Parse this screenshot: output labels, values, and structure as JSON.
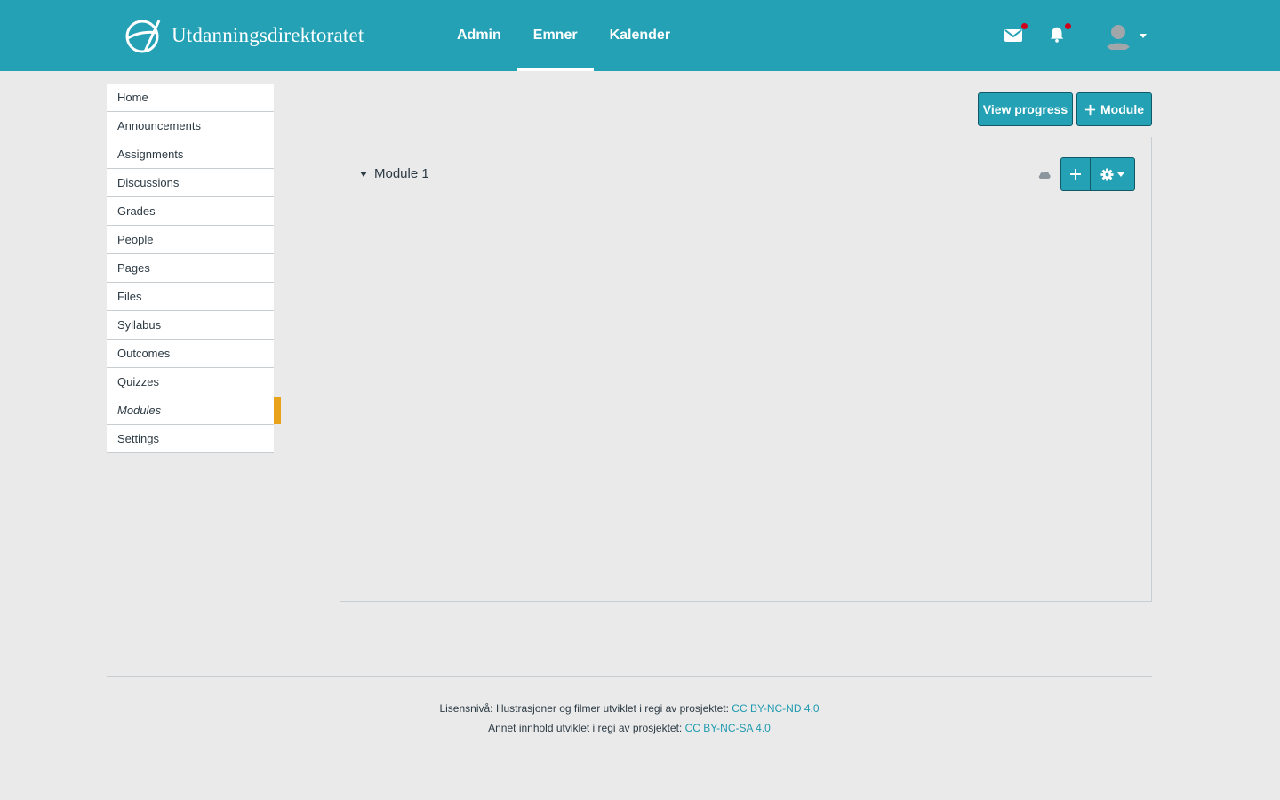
{
  "header": {
    "brand": "Utdanningsdirektoratet",
    "nav": [
      {
        "label": "Admin",
        "active": false
      },
      {
        "label": "Emner",
        "active": true
      },
      {
        "label": "Kalender",
        "active": false
      }
    ],
    "icons": [
      "envelope-icon",
      "bell-icon",
      "user-avatar-icon"
    ]
  },
  "sidebar": {
    "items": [
      {
        "label": "Home"
      },
      {
        "label": "Announcements"
      },
      {
        "label": "Assignments"
      },
      {
        "label": "Discussions"
      },
      {
        "label": "Grades"
      },
      {
        "label": "People"
      },
      {
        "label": "Pages"
      },
      {
        "label": "Files"
      },
      {
        "label": "Syllabus"
      },
      {
        "label": "Outcomes"
      },
      {
        "label": "Quizzes"
      },
      {
        "label": "Modules"
      },
      {
        "label": "Settings"
      }
    ],
    "active_index": 11
  },
  "toolbar": {
    "view_progress_label": "View progress",
    "add_module_label": "Module",
    "add_module_icon": "plus-icon"
  },
  "module": {
    "title": "Module 1",
    "icons": [
      "cloud-icon",
      "plus-icon",
      "gear-icon"
    ]
  },
  "footer": {
    "line1_text": "Lisensnivå: Illustrasjoner og filmer utviklet i regi av prosjektet: ",
    "line1_link": "CC BY-NC-ND 4.0",
    "line2_text": "Annet innhold utviklet i regi av prosjektet: ",
    "line2_link": "CC BY-NC-SA 4.0"
  },
  "colors": {
    "brand": "#24a1b5",
    "active_marker": "#e9a31b",
    "notification_dot": "#d0021b",
    "link": "#1f9bb0"
  }
}
